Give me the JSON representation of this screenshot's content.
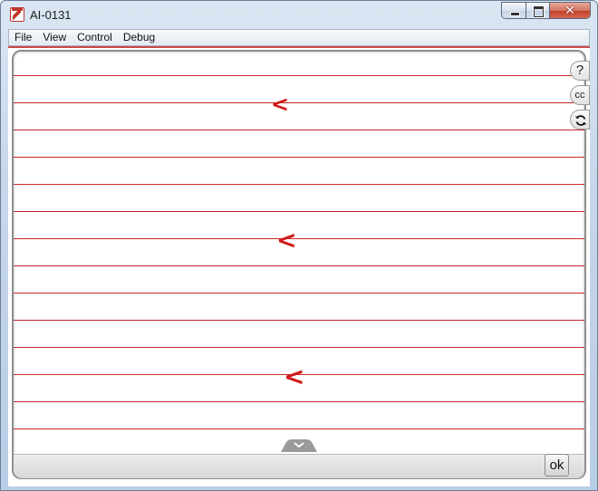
{
  "window": {
    "title": "AI-0131"
  },
  "menu": {
    "items": [
      "File",
      "View",
      "Control",
      "Debug"
    ]
  },
  "side_buttons": {
    "help": "?",
    "cc": "cc"
  },
  "glyphs": [
    "<",
    "<",
    "<"
  ],
  "footer": {
    "ok_label": "ok"
  },
  "colors": {
    "accent": "#c62828",
    "glyph": "#d21a1a"
  },
  "icons": {
    "app": "flash-app-icon",
    "minimize": "minimize-icon",
    "maximize": "maximize-icon",
    "close": "close-icon",
    "refresh": "refresh-icon",
    "drawer": "chevron-down-icon"
  }
}
